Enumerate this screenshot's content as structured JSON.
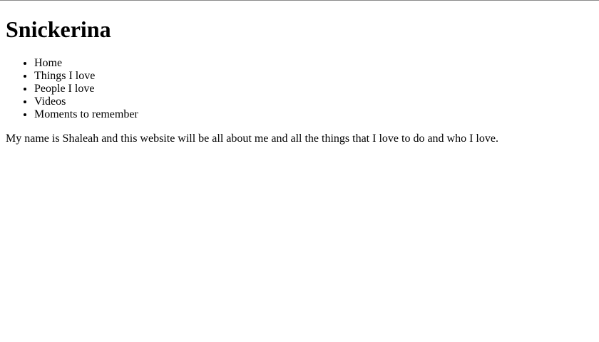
{
  "site": {
    "title": "Snickerina"
  },
  "nav": {
    "items": [
      {
        "label": "Home"
      },
      {
        "label": "Things I love"
      },
      {
        "label": "People I love"
      },
      {
        "label": "Videos"
      },
      {
        "label": "Moments to remember"
      }
    ]
  },
  "main": {
    "intro": "My name is Shaleah and this website will be all about me and all the things that I love to do and who I love."
  },
  "colors": {
    "text": "#000000",
    "background": "#ffffff",
    "top_border": "#8a8a8a"
  }
}
